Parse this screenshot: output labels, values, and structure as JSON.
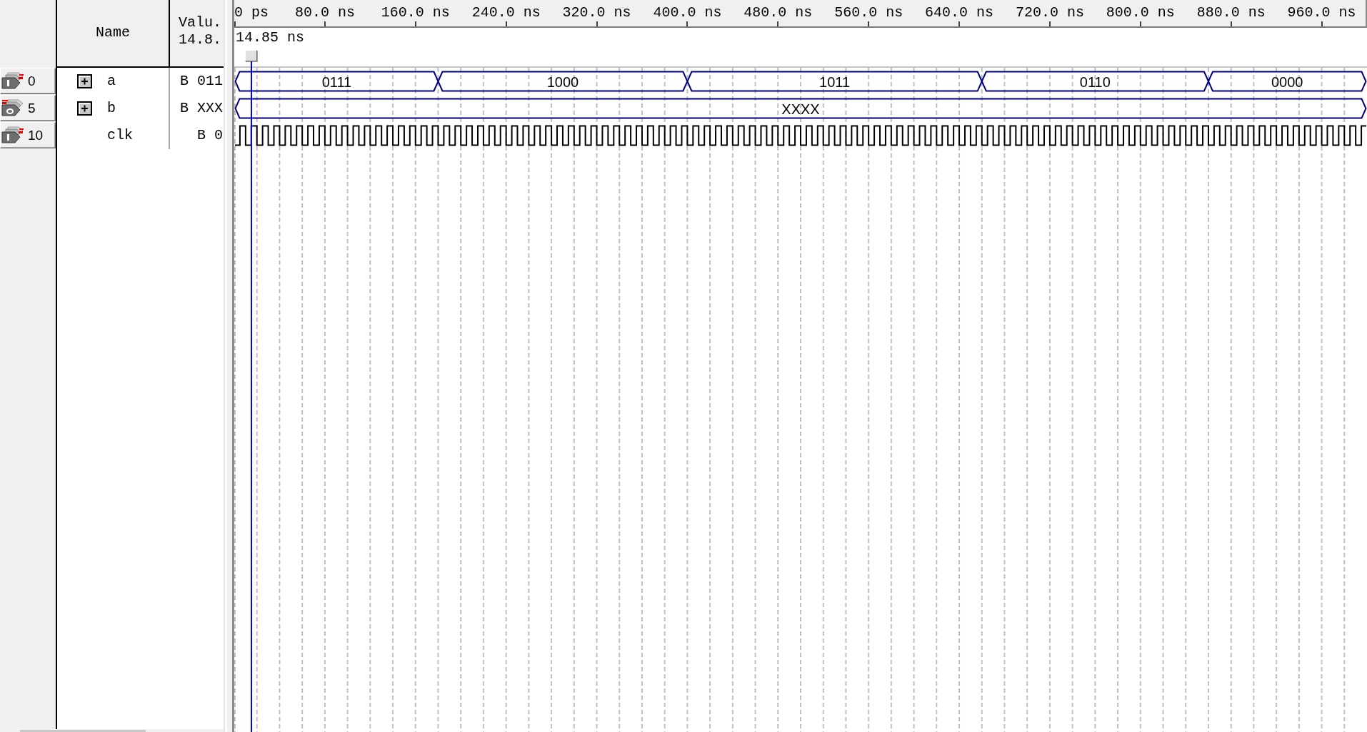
{
  "signal_list": {
    "name_header": "Name",
    "value_header": "Valu.",
    "cursor_value_header": "14.8."
  },
  "time_ruler": {
    "ticks": [
      "0 ps",
      "80.0 ns",
      "160.0 ns",
      "240.0 ns",
      "320.0 ns",
      "400.0 ns",
      "480.0 ns",
      "560.0 ns",
      "640.0 ns",
      "720.0 ns",
      "800.0 ns",
      "880.0 ns",
      "960.0 ns"
    ]
  },
  "cursor": {
    "time": "14.85 ns"
  },
  "signals": [
    {
      "index": "0",
      "kind": "input",
      "expanded": false,
      "name": "a",
      "value": "B 011",
      "wave": {
        "kind": "bus",
        "segments": [
          {
            "label": "0111"
          },
          {
            "label": "1000"
          },
          {
            "label": "1011"
          },
          {
            "label": "0110"
          },
          {
            "label": "0000"
          }
        ]
      }
    },
    {
      "index": "5",
      "kind": "output",
      "expanded": false,
      "name": "b",
      "value": "B XXX",
      "wave": {
        "kind": "bus",
        "segments": [
          {
            "label": "XXXX"
          }
        ]
      }
    },
    {
      "index": "10",
      "kind": "input",
      "name": "clk",
      "value": "B 0",
      "wave": {
        "kind": "clock"
      }
    }
  ]
}
